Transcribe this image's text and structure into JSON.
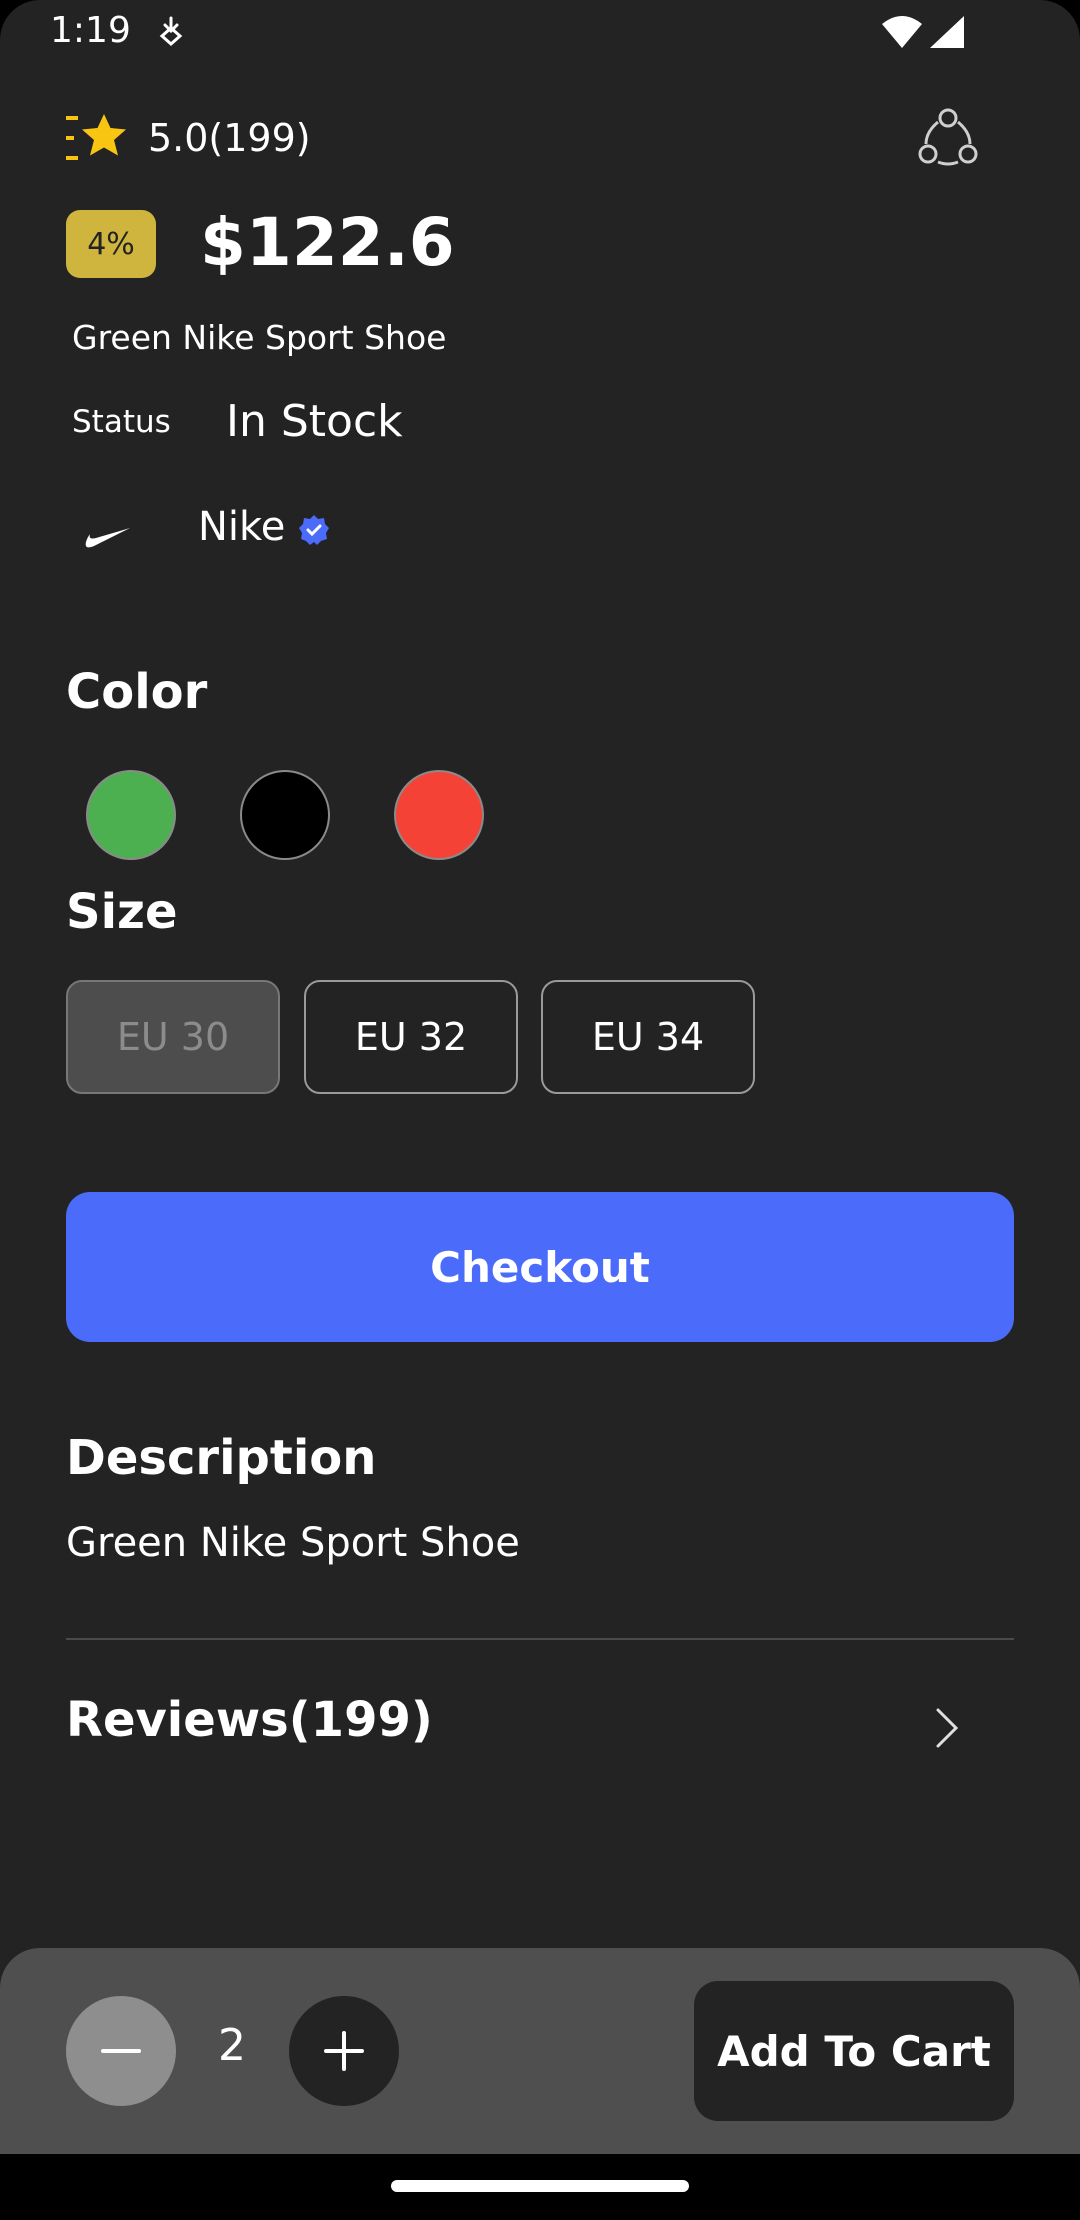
{
  "status_bar": {
    "time": "1:19"
  },
  "product": {
    "rating": "5.0(199)",
    "discount": "4%",
    "price": "$122.6",
    "name": "Green Nike Sport Shoe",
    "status_label": "Status",
    "status_value": "In Stock",
    "brand": "Nike"
  },
  "color_section": {
    "title": "Color",
    "options": [
      {
        "color": "#4caf50"
      },
      {
        "color": "#000000"
      },
      {
        "color": "#f44336"
      }
    ]
  },
  "size_section": {
    "title": "Size",
    "options": [
      {
        "label": "EU 30",
        "selected": true
      },
      {
        "label": "EU 32",
        "selected": false
      },
      {
        "label": "EU 34",
        "selected": false
      }
    ]
  },
  "checkout_label": "Checkout",
  "description": {
    "title": "Description",
    "text": "Green Nike Sport Shoe"
  },
  "reviews": {
    "title": "Reviews(199)"
  },
  "cart": {
    "quantity": "2",
    "add_label": "Add To Cart"
  },
  "colors": {
    "accent": "#4b6bfb",
    "badge": "#cfb43d",
    "star": "#f9c513",
    "background": "#232323"
  }
}
